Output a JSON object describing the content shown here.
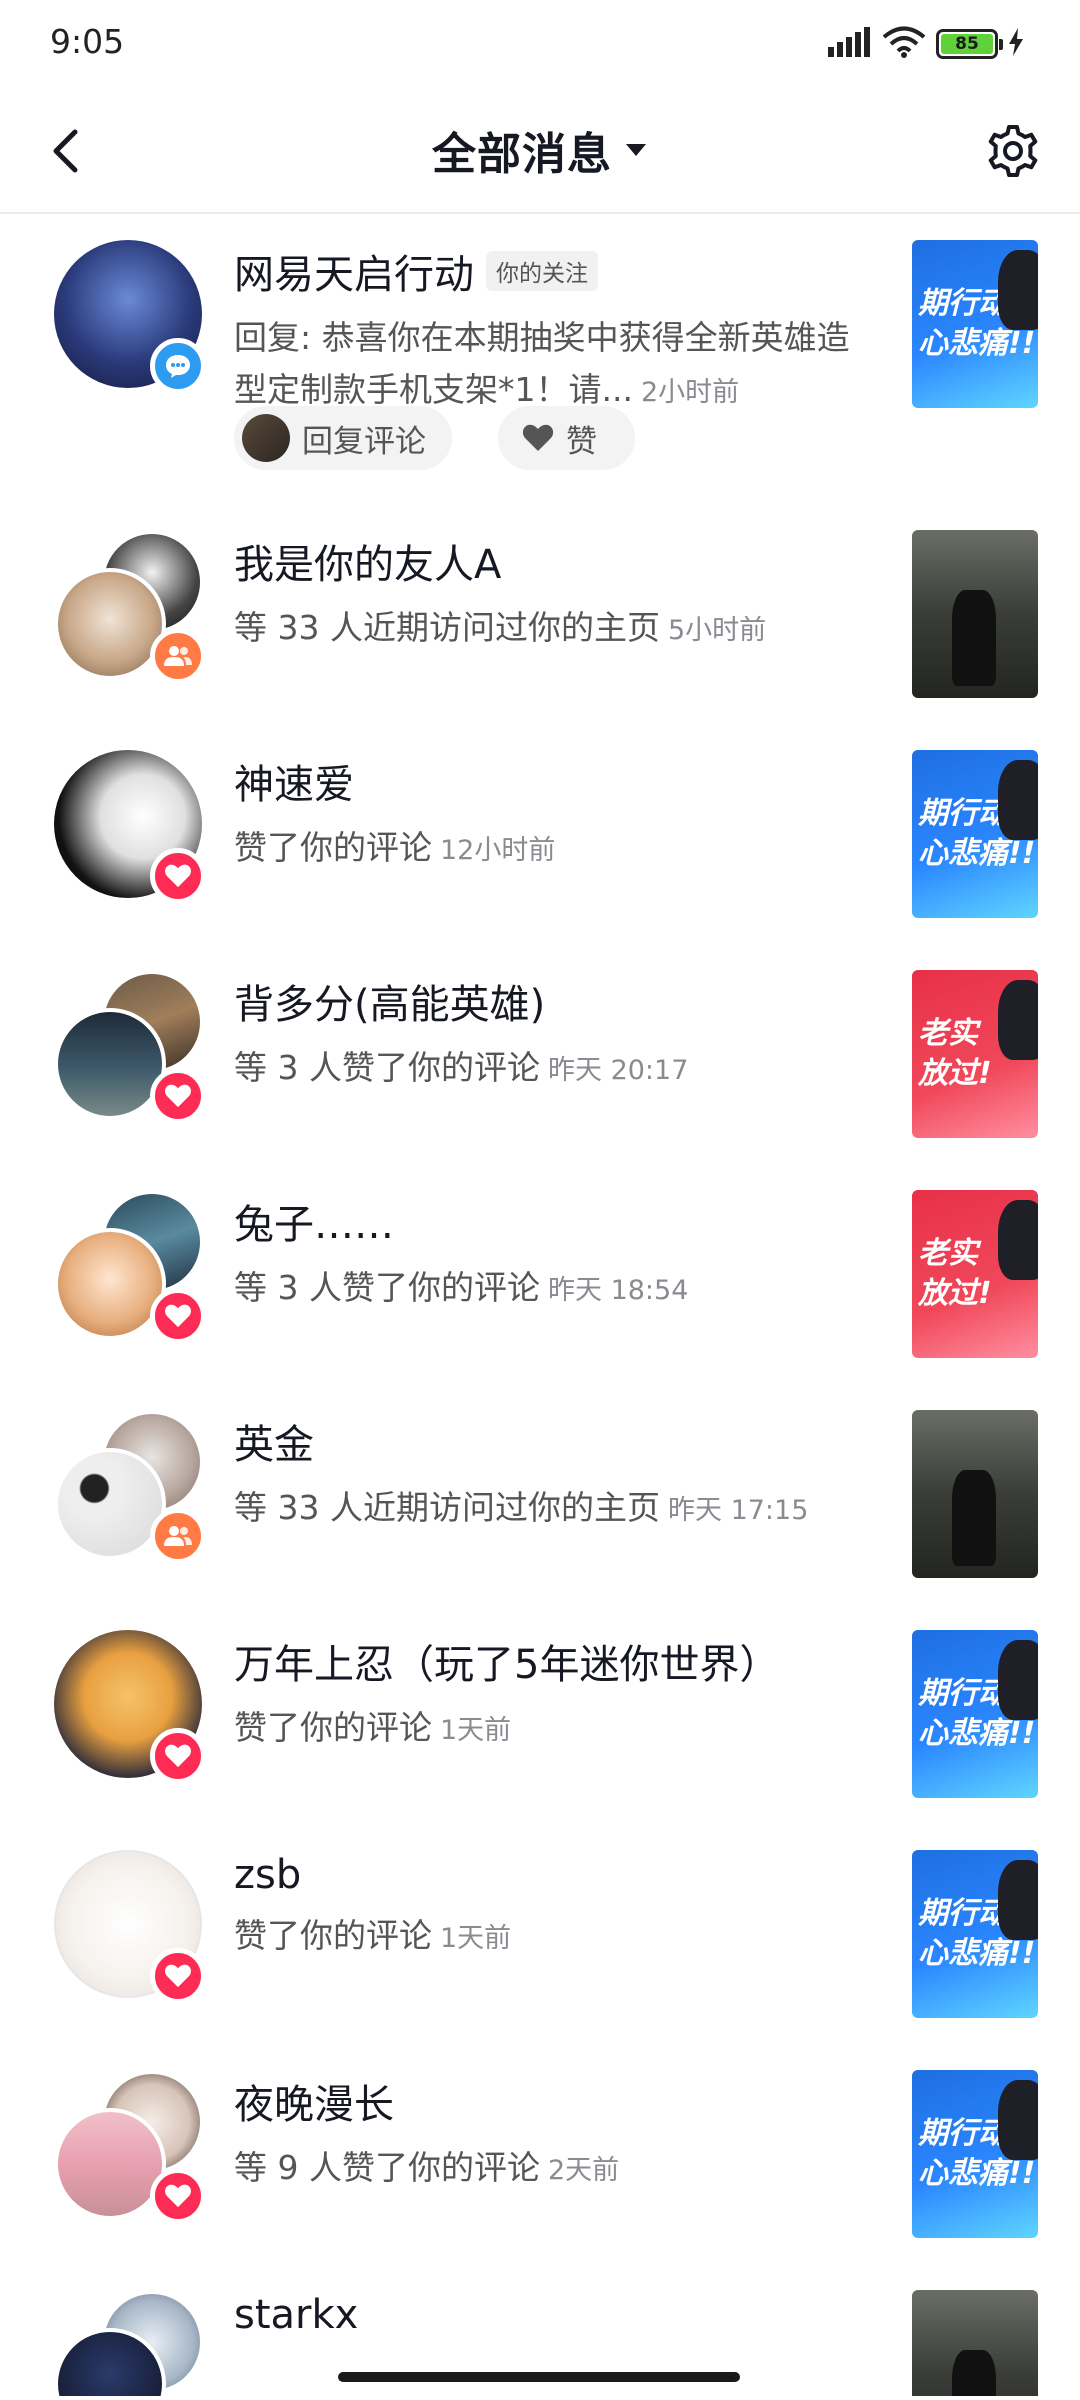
{
  "status_bar": {
    "time": "9:05",
    "battery": "85"
  },
  "header": {
    "title": "全部消息"
  },
  "messages": [
    {
      "name": "网易天启行动",
      "tag": "你的关注",
      "text": "回复: 恭喜你在本期抽奖中获得全新英雄造型定制款手机支架*1！请...",
      "time": "2小时前",
      "reply_label": "回复评论",
      "like_label": "赞"
    },
    {
      "name": "我是你的友人A",
      "text": "等 33 人近期访问过你的主页",
      "time": "5小时前"
    },
    {
      "name": "神速爱",
      "text": "赞了你的评论",
      "time": "12小时前"
    },
    {
      "name": "背多分(高能英雄)",
      "text": "等 3 人赞了你的评论",
      "time": "昨天 20:17"
    },
    {
      "name": "兔子……",
      "text": "等 3 人赞了你的评论",
      "time": "昨天 18:54"
    },
    {
      "name": "英金",
      "text": "等 33 人近期访问过你的主页",
      "time": "昨天 17:15"
    },
    {
      "name": "万年上忍（玩了5年迷你世界）",
      "text": "赞了你的评论",
      "time": "1天前"
    },
    {
      "name": "zsb",
      "text": "赞了你的评论",
      "time": "1天前"
    },
    {
      "name": "夜晚漫长",
      "text": "等 9 人赞了你的评论",
      "time": "2天前"
    },
    {
      "name": "starkx"
    }
  ],
  "thumb_text": {
    "blue": [
      "期行动",
      "心悲痛!!"
    ],
    "red": [
      "老实",
      "放过!"
    ]
  },
  "colors": {
    "like_badge": "#fe2c55",
    "visit_badge": "#ff7a45",
    "comment_badge": "#2d9bf0"
  }
}
